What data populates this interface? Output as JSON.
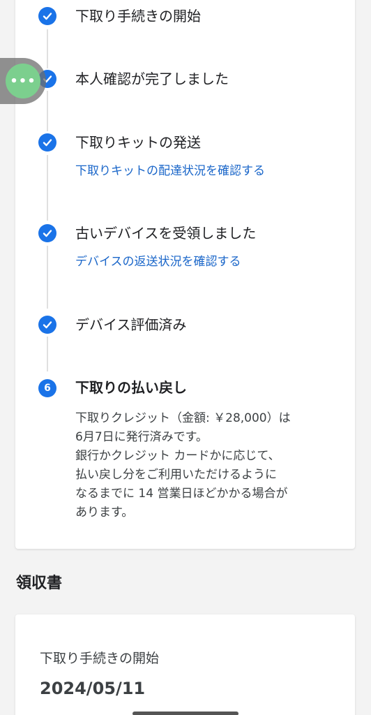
{
  "steps": [
    {
      "title": "下取り手続きの開始",
      "done": true
    },
    {
      "title": "本人確認が完了しました",
      "done": true
    },
    {
      "title": "下取りキットの発送",
      "done": true,
      "link": "下取りキットの配達状況を確認する"
    },
    {
      "title": "古いデバイスを受領しました",
      "done": true,
      "link": "デバイスの返送状況を確認する"
    },
    {
      "title": "デバイス評価済み",
      "done": true
    },
    {
      "title": "下取りの払い戻し",
      "number": "6",
      "desc": [
        "下取りクレジット（金額: ￥28,000）は",
        "6月7日に発行済みです。",
        "銀行かクレジット カードかに応じて、",
        "払い戻し分をご利用いただけるように",
        "なるまでに 14 営業日ほどかかる場合が",
        "あります。"
      ]
    }
  ],
  "receipt": {
    "section_title": "領収書",
    "label": "下取り手続きの開始",
    "date": "2024/05/11"
  },
  "floating_button": {
    "label": "•••"
  },
  "colors": {
    "accent": "#1a73e8",
    "link": "#1a66c9",
    "floating": "#7ccf8e"
  }
}
